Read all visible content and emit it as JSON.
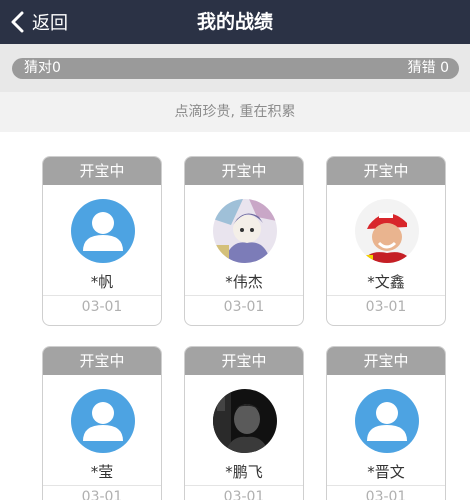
{
  "header": {
    "back_label": "返回",
    "title": "我的战绩"
  },
  "stats": {
    "correct": "猜对0",
    "wrong": "猜错 0"
  },
  "motto": "点滴珍贵, 重在积累",
  "cards": [
    {
      "status": "开宝中",
      "name": "*帆",
      "date": "03-01",
      "avatar": "default-user-avatar"
    },
    {
      "status": "开宝中",
      "name": "*伟杰",
      "date": "03-01",
      "avatar": "anime-photo-avatar"
    },
    {
      "status": "开宝中",
      "name": "*文鑫",
      "date": "03-01",
      "avatar": "racing-driver-photo-avatar"
    },
    {
      "status": "开宝中",
      "name": "*莹",
      "date": "03-01",
      "avatar": "default-user-avatar"
    },
    {
      "status": "开宝中",
      "name": "*鹏飞",
      "date": "03-01",
      "avatar": "dark-portrait-photo-avatar"
    },
    {
      "status": "开宝中",
      "name": "*晋文",
      "date": "03-01",
      "avatar": "default-user-avatar"
    }
  ],
  "colors": {
    "header": "#2b3245",
    "avatar_default": "#4da3e2",
    "status_bar": "#a3a3a3"
  }
}
